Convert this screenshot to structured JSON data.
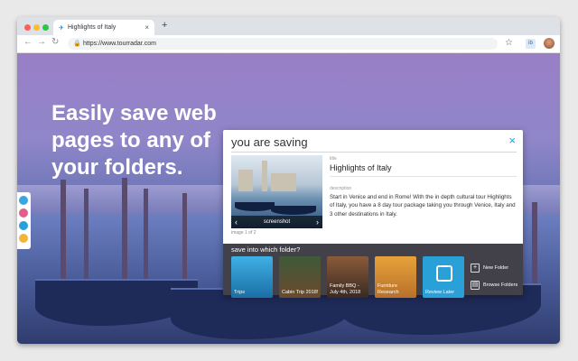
{
  "browser": {
    "tab_title": "Highlights of Italy",
    "tab_close": "×",
    "new_tab": "+",
    "url": "https://www.tourradar.com",
    "ext_label": "ib",
    "colors": {
      "close": "#ff5f57",
      "minimize": "#febc2e",
      "maximize": "#28c840"
    }
  },
  "hero": {
    "headline": "Easily save web pages to any of your folders."
  },
  "panel": {
    "heading": "you are saving",
    "close": "×",
    "thumbnail": {
      "label": "screenshot",
      "count": "image 1 of 2"
    },
    "title_label": "title",
    "title": "Highlights of Italy",
    "description_label": "description",
    "description": "Start in Venice and end in Rome! With the in depth cultural tour Highlights of Italy, you have a 8 day tour package taking you through Venice, Italy and 3 other destinations in Italy.",
    "save_prompt": "save into which folder?",
    "folders": [
      {
        "name": "Trips"
      },
      {
        "name": "Cabin Trip 2018!"
      },
      {
        "name": "Family BBQ - July 4th, 2018"
      },
      {
        "name": "Furniture Research"
      },
      {
        "name": "Review Later"
      }
    ],
    "actions": {
      "new_folder": "New Folder",
      "browse_folders": "Browse Folders"
    },
    "accent": "#2aa0d8"
  }
}
